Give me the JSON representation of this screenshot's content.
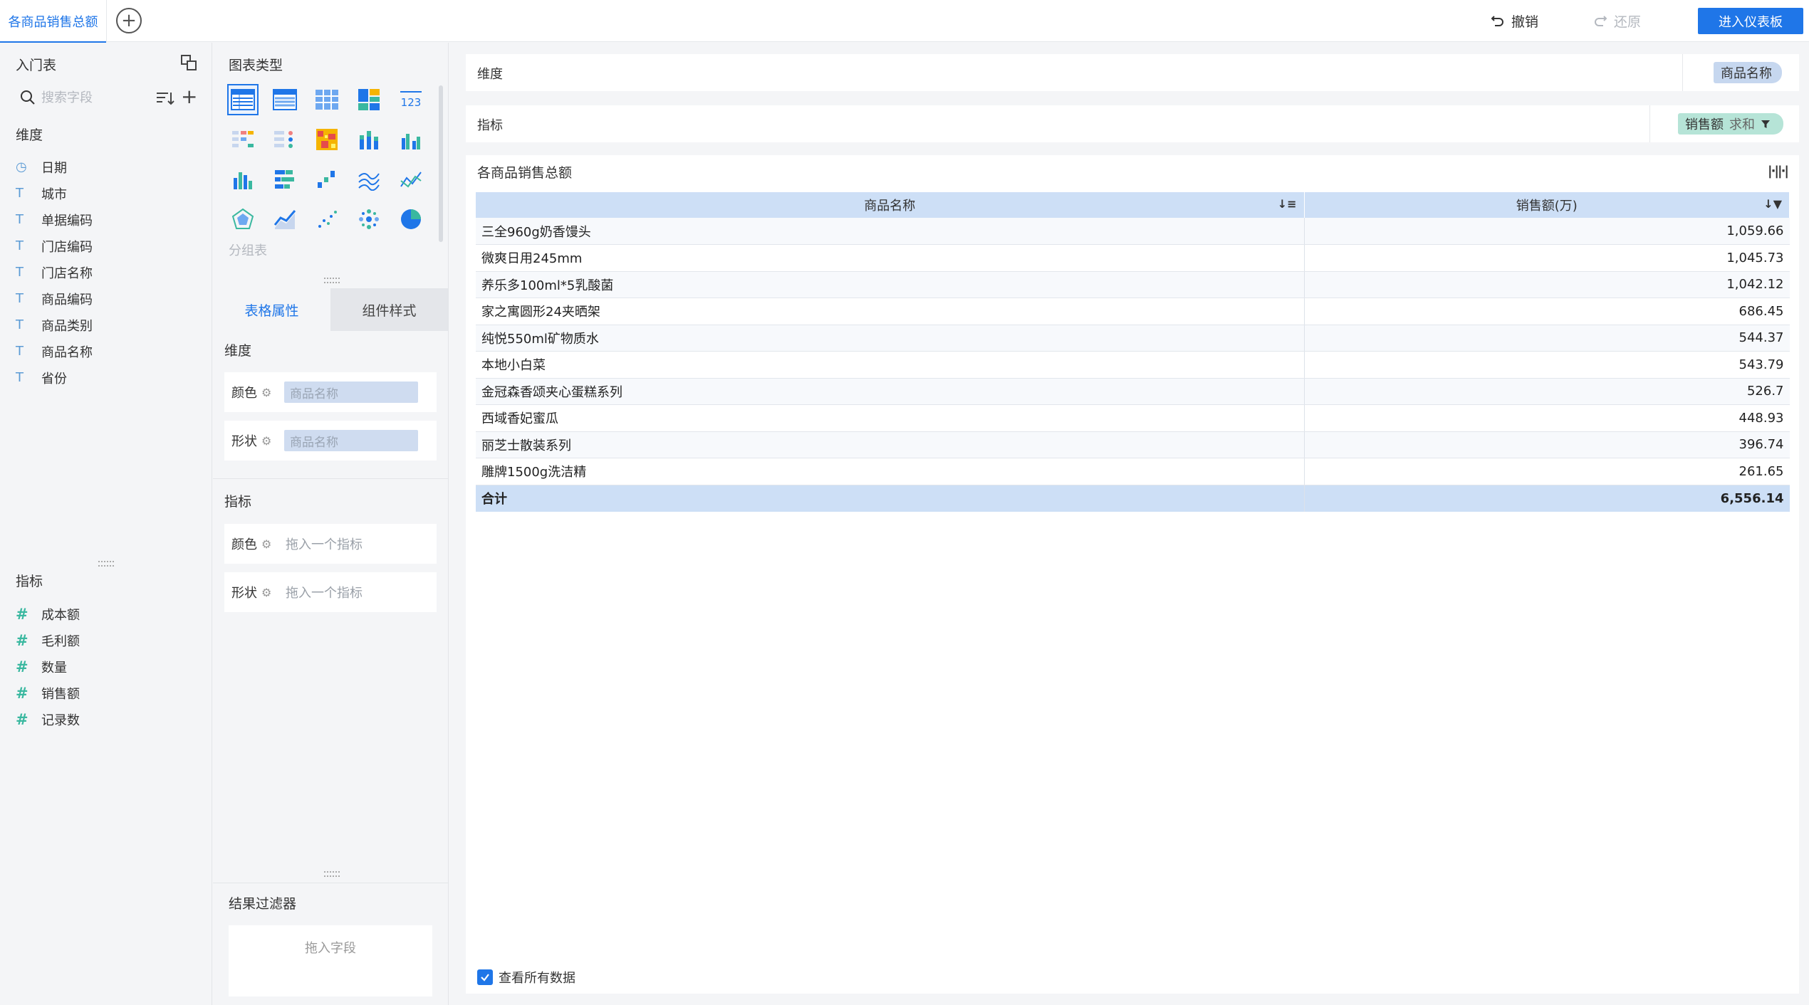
{
  "topbar": {
    "tab_label": "各商品销售总额",
    "undo_label": "撤销",
    "redo_label": "还原",
    "enter_dashboard_label": "进入仪表板"
  },
  "left_panel": {
    "dataset_name": "入门表",
    "search_placeholder": "搜索字段",
    "dimensions_title": "维度",
    "dimensions": [
      {
        "label": "日期",
        "icon": "clock-icon"
      },
      {
        "label": "城市",
        "icon": "text-type-icon"
      },
      {
        "label": "单据编码",
        "icon": "text-type-icon"
      },
      {
        "label": "门店编码",
        "icon": "text-type-icon"
      },
      {
        "label": "门店名称",
        "icon": "text-type-icon"
      },
      {
        "label": "商品编码",
        "icon": "text-type-icon"
      },
      {
        "label": "商品类别",
        "icon": "text-type-icon"
      },
      {
        "label": "商品名称",
        "icon": "text-type-icon"
      },
      {
        "label": "省份",
        "icon": "text-type-icon"
      }
    ],
    "measures_title": "指标",
    "measures": [
      {
        "label": "成本额",
        "icon": "number-type-icon"
      },
      {
        "label": "毛利额",
        "icon": "number-type-icon"
      },
      {
        "label": "数量",
        "icon": "number-type-icon"
      },
      {
        "label": "销售额",
        "icon": "number-type-icon"
      },
      {
        "label": "记录数",
        "icon": "number-type-icon"
      }
    ]
  },
  "mid_panel": {
    "chart_type_title": "图表类型",
    "selected_chart_type": "分组表",
    "group_table_label": "分组表",
    "tabs": [
      {
        "label": "表格属性",
        "active": true
      },
      {
        "label": "组件样式",
        "active": false
      }
    ],
    "dimension_section": {
      "title": "维度",
      "color_label": "颜色",
      "color_value": "商品名称",
      "shape_label": "形状",
      "shape_value": "商品名称"
    },
    "measure_section": {
      "title": "指标",
      "color_label": "颜色",
      "color_placeholder": "拖入一个指标",
      "shape_label": "形状",
      "shape_placeholder": "拖入一个指标"
    },
    "result_filter": {
      "title": "结果过滤器",
      "placeholder": "拖入字段"
    }
  },
  "shelves": {
    "dimension_label": "维度",
    "dimension_pill": "商品名称",
    "measure_label": "指标",
    "measure_pill": "销售额",
    "measure_agg": "求和"
  },
  "canvas": {
    "title": "各商品销售总额",
    "columns": [
      "商品名称",
      "销售额(万)"
    ],
    "rows": [
      {
        "name": "三全960g奶香馒头",
        "value": "1,059.66"
      },
      {
        "name": "微爽日用245mm",
        "value": "1,045.73"
      },
      {
        "name": "养乐多100ml*5乳酸菌",
        "value": "1,042.12"
      },
      {
        "name": "家之寓圆形24夹晒架",
        "value": "686.45"
      },
      {
        "name": "纯悦550ml矿物质水",
        "value": "544.37"
      },
      {
        "name": "本地小白菜",
        "value": "543.79"
      },
      {
        "name": "金冠森香颂夹心蛋糕系列",
        "value": "526.7"
      },
      {
        "name": "西域香妃蜜瓜",
        "value": "448.93"
      },
      {
        "name": "丽芝士散装系列",
        "value": "396.74"
      },
      {
        "name": "雕牌1500g洗洁精",
        "value": "261.65"
      }
    ],
    "total": {
      "name": "合计",
      "value": "6,556.14"
    },
    "view_all_label": "查看所有数据",
    "view_all_checked": true
  },
  "colors": {
    "accent": "#1f76e8",
    "dimension_pill": "#c6d7ef",
    "measure_pill": "#b6e4d7",
    "header_bg": "#cddff6"
  }
}
